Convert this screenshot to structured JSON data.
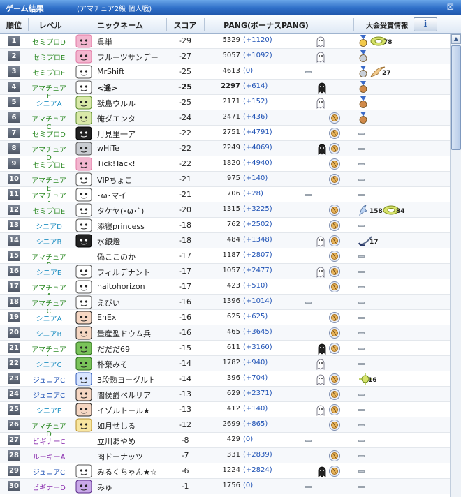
{
  "window": {
    "title": "ゲーム結果",
    "subtitle": "(アマチュア2級 個人戦)",
    "close_glyph": "⊠"
  },
  "header": {
    "rank": "順位",
    "level": "レベル",
    "nickname": "ニックネーム",
    "score": "スコア",
    "pang": "PANG(ボーナスPANG)",
    "awards": "大会受賞情報",
    "info_button": "i"
  },
  "colors": {
    "semipro": "#2c8a24",
    "amateur": "#2c8a24",
    "senior": "#1f8fc2",
    "junior": "#1f52b5",
    "beginner": "#8a2cae",
    "rookie": "#8a2cae"
  },
  "rows": [
    {
      "rank": "1",
      "level": "セミプロD",
      "lvcolor": "#2c8a24",
      "avatar": "pink",
      "nick": "呉単",
      "score": "-29",
      "pang": "5329",
      "bonus": "(+1120)",
      "bold": false,
      "st": [
        "g"
      ],
      "awards": [
        "gold",
        "tire"
      ],
      "counts": [
        "",
        "78"
      ]
    },
    {
      "rank": "2",
      "level": "セミプロE",
      "lvcolor": "#2c8a24",
      "avatar": "pink",
      "nick": "フルーツサンデー",
      "score": "-27",
      "pang": "5057",
      "bonus": "(+1092)",
      "bold": false,
      "st": [
        "g"
      ],
      "awards": [
        "silver"
      ],
      "counts": [
        ""
      ]
    },
    {
      "rank": "3",
      "level": "セミプロE",
      "lvcolor": "#2c8a24",
      "avatar": "white",
      "nick": "MrShift",
      "score": "-25",
      "pang": "4613",
      "bonus": "(0)",
      "bold": false,
      "st": [
        "dash"
      ],
      "awards": [
        "silver",
        "feather"
      ],
      "counts": [
        "",
        "27"
      ]
    },
    {
      "rank": "4",
      "level": "アマチュアE",
      "lvcolor": "#2c8a24",
      "avatar": "white",
      "nick": "<遙>",
      "score": "-25",
      "pang": "2297",
      "bonus": "(+614)",
      "bold": true,
      "st": [
        "b"
      ],
      "awards": [
        "bronze"
      ],
      "counts": [
        ""
      ]
    },
    {
      "rank": "5",
      "level": "シニアA",
      "lvcolor": "#1f8fc2",
      "avatar": "green",
      "nick": "獸島ウルル",
      "score": "-25",
      "pang": "2171",
      "bonus": "(+152)",
      "bold": false,
      "st": [
        "g"
      ],
      "awards": [
        "bronze"
      ],
      "counts": [
        ""
      ]
    },
    {
      "rank": "6",
      "level": "アマチュアC",
      "lvcolor": "#2c8a24",
      "avatar": "green",
      "nick": "俺ダエンタ",
      "score": "-24",
      "pang": "2471",
      "bonus": "(+436)",
      "bold": false,
      "st": [
        "c"
      ],
      "awards": [
        "bronze"
      ],
      "counts": [
        ""
      ]
    },
    {
      "rank": "7",
      "level": "セミプロD",
      "lvcolor": "#2c8a24",
      "avatar": "black",
      "nick": "月見里一ア",
      "score": "-22",
      "pang": "2751",
      "bonus": "(+4791)",
      "bold": false,
      "st": [
        "c"
      ],
      "awards": [
        "dash"
      ],
      "counts": [
        ""
      ]
    },
    {
      "rank": "8",
      "level": "アマチュアD",
      "lvcolor": "#2c8a24",
      "avatar": "tower",
      "nick": "wHiTe",
      "score": "-22",
      "pang": "2249",
      "bonus": "(+4069)",
      "bold": false,
      "st": [
        "b",
        "c"
      ],
      "awards": [
        "dash"
      ],
      "counts": [
        ""
      ]
    },
    {
      "rank": "9",
      "level": "セミプロE",
      "lvcolor": "#2c8a24",
      "avatar": "pink",
      "nick": "Tick!Tack!",
      "score": "-22",
      "pang": "1820",
      "bonus": "(+4940)",
      "bold": false,
      "st": [
        "c"
      ],
      "awards": [
        "dash"
      ],
      "counts": [
        ""
      ]
    },
    {
      "rank": "10",
      "level": "アマチュアE",
      "lvcolor": "#2c8a24",
      "avatar": "white",
      "nick": "VIPちょこ",
      "score": "-21",
      "pang": "975",
      "bonus": "(+140)",
      "bold": false,
      "st": [
        "c"
      ],
      "awards": [
        "dash"
      ],
      "counts": [
        ""
      ]
    },
    {
      "rank": "11",
      "level": "アマチュアA",
      "lvcolor": "#2c8a24",
      "avatar": "white",
      "nick": "･ω･マイ",
      "score": "-21",
      "pang": "706",
      "bonus": "(+28)",
      "bold": false,
      "st": [
        "dash"
      ],
      "awards": [
        "dash"
      ],
      "counts": [
        ""
      ]
    },
    {
      "rank": "12",
      "level": "セミプロE",
      "lvcolor": "#2c8a24",
      "avatar": "white",
      "nick": "タケヤ(･ω･`)",
      "score": "-20",
      "pang": "1315",
      "bonus": "(+3225)",
      "bold": false,
      "st": [
        "c"
      ],
      "awards": [
        "wings",
        "tire"
      ],
      "counts": [
        "158",
        "84"
      ]
    },
    {
      "rank": "13",
      "level": "シニアD",
      "lvcolor": "#1f8fc2",
      "avatar": "white",
      "nick": "添寝princess",
      "score": "-18",
      "pang": "762",
      "bonus": "(+2502)",
      "bold": false,
      "st": [
        "c"
      ],
      "awards": [
        "dash"
      ],
      "counts": [
        ""
      ]
    },
    {
      "rank": "14",
      "level": "シニアB",
      "lvcolor": "#1f8fc2",
      "avatar": "black",
      "nick": "水銀燈",
      "score": "-18",
      "pang": "484",
      "bonus": "(+1348)",
      "bold": false,
      "st": [
        "g",
        "c"
      ],
      "awards": [
        "club"
      ],
      "counts": [
        "17"
      ]
    },
    {
      "rank": "15",
      "level": "アマチュアB",
      "lvcolor": "#2c8a24",
      "avatar": "none",
      "nick": "偽ここのか",
      "score": "-17",
      "pang": "1187",
      "bonus": "(+2807)",
      "bold": false,
      "st": [
        "c"
      ],
      "awards": [
        "dash"
      ],
      "counts": [
        ""
      ]
    },
    {
      "rank": "16",
      "level": "シニアE",
      "lvcolor": "#1f8fc2",
      "avatar": "white",
      "nick": "フィルデナント",
      "score": "-17",
      "pang": "1057",
      "bonus": "(+2477)",
      "bold": false,
      "st": [
        "g",
        "c"
      ],
      "awards": [
        "dash"
      ],
      "counts": [
        ""
      ]
    },
    {
      "rank": "17",
      "level": "アマチュアA",
      "lvcolor": "#2c8a24",
      "avatar": "white",
      "nick": "naitohorizon",
      "score": "-17",
      "pang": "423",
      "bonus": "(+510)",
      "bold": false,
      "st": [
        "c"
      ],
      "awards": [
        "dash"
      ],
      "counts": [
        ""
      ]
    },
    {
      "rank": "18",
      "level": "アマチュアC",
      "lvcolor": "#2c8a24",
      "avatar": "white",
      "nick": "えびい",
      "score": "-16",
      "pang": "1396",
      "bonus": "(+1014)",
      "bold": false,
      "st": [
        "dash"
      ],
      "awards": [
        "dash"
      ],
      "counts": [
        ""
      ]
    },
    {
      "rank": "19",
      "level": "シニアA",
      "lvcolor": "#1f8fc2",
      "avatar": "girl",
      "nick": "EnEx",
      "score": "-16",
      "pang": "625",
      "bonus": "(+625)",
      "bold": false,
      "st": [
        "c"
      ],
      "awards": [
        "dash"
      ],
      "counts": [
        ""
      ]
    },
    {
      "rank": "20",
      "level": "シニアB",
      "lvcolor": "#1f8fc2",
      "avatar": "girl",
      "nick": "量産型ドウム兵",
      "score": "-16",
      "pang": "465",
      "bonus": "(+3645)",
      "bold": false,
      "st": [
        "c"
      ],
      "awards": [
        "dash"
      ],
      "counts": [
        ""
      ]
    },
    {
      "rank": "21",
      "level": "アマチュアE",
      "lvcolor": "#2c8a24",
      "avatar": "frog",
      "nick": "だだだ69",
      "score": "-15",
      "pang": "611",
      "bonus": "(+3160)",
      "bold": false,
      "st": [
        "b",
        "c"
      ],
      "awards": [
        "dash"
      ],
      "counts": [
        ""
      ]
    },
    {
      "rank": "22",
      "level": "シニアC",
      "lvcolor": "#1f8fc2",
      "avatar": "frog",
      "nick": "朴葉みそ",
      "score": "-14",
      "pang": "1782",
      "bonus": "(+940)",
      "bold": false,
      "st": [
        "g"
      ],
      "awards": [
        "dash"
      ],
      "counts": [
        ""
      ]
    },
    {
      "rank": "23",
      "level": "ジュニアC",
      "lvcolor": "#1f52b5",
      "avatar": "cup",
      "nick": "3段熟ヨーグルト",
      "score": "-14",
      "pang": "396",
      "bonus": "(+704)",
      "bold": false,
      "st": [
        "g",
        "c"
      ],
      "awards": [
        "spark"
      ],
      "counts": [
        "16"
      ]
    },
    {
      "rank": "24",
      "level": "ジュニアC",
      "lvcolor": "#1f52b5",
      "avatar": "girl",
      "nick": "闇侯爵ベルリア",
      "score": "-13",
      "pang": "629",
      "bonus": "(+2371)",
      "bold": false,
      "st": [
        "c"
      ],
      "awards": [
        "dash"
      ],
      "counts": [
        ""
      ]
    },
    {
      "rank": "25",
      "level": "シニアE",
      "lvcolor": "#1f8fc2",
      "avatar": "girl",
      "nick": "イゾルトール★",
      "score": "-13",
      "pang": "412",
      "bonus": "(+140)",
      "bold": false,
      "st": [
        "g",
        "c"
      ],
      "awards": [
        "dash"
      ],
      "counts": [
        ""
      ]
    },
    {
      "rank": "26",
      "level": "アマチュアD",
      "lvcolor": "#2c8a24",
      "avatar": "blond",
      "nick": "如月せしる",
      "score": "-12",
      "pang": "2699",
      "bonus": "(+865)",
      "bold": false,
      "st": [
        "c"
      ],
      "awards": [
        "dash"
      ],
      "counts": [
        ""
      ]
    },
    {
      "rank": "27",
      "level": "ビギナーC",
      "lvcolor": "#8a2cae",
      "avatar": "none",
      "nick": "立川あやめ",
      "score": "-8",
      "pang": "429",
      "bonus": "(0)",
      "bold": false,
      "st": [
        "dash"
      ],
      "awards": [
        "dash"
      ],
      "counts": [
        ""
      ]
    },
    {
      "rank": "28",
      "level": "ルーキーA",
      "lvcolor": "#8a2cae",
      "avatar": "none",
      "nick": "肉ドーナッツ",
      "score": "-7",
      "pang": "331",
      "bonus": "(+2839)",
      "bold": false,
      "st": [
        "c"
      ],
      "awards": [
        "dash"
      ],
      "counts": [
        ""
      ]
    },
    {
      "rank": "29",
      "level": "ジュニアC",
      "lvcolor": "#1f52b5",
      "avatar": "white",
      "nick": "みるくちゃん★☆",
      "score": "-6",
      "pang": "1224",
      "bonus": "(+2824)",
      "bold": false,
      "st": [
        "b",
        "c"
      ],
      "awards": [
        "dash"
      ],
      "counts": [
        ""
      ]
    },
    {
      "rank": "30",
      "level": "ビギナーD",
      "lvcolor": "#8a2cae",
      "avatar": "purple",
      "nick": "みゅ",
      "score": "-1",
      "pang": "1756",
      "bonus": "(0)",
      "bold": false,
      "st": [
        "dash"
      ],
      "awards": [
        "dash"
      ],
      "counts": [
        ""
      ]
    }
  ]
}
